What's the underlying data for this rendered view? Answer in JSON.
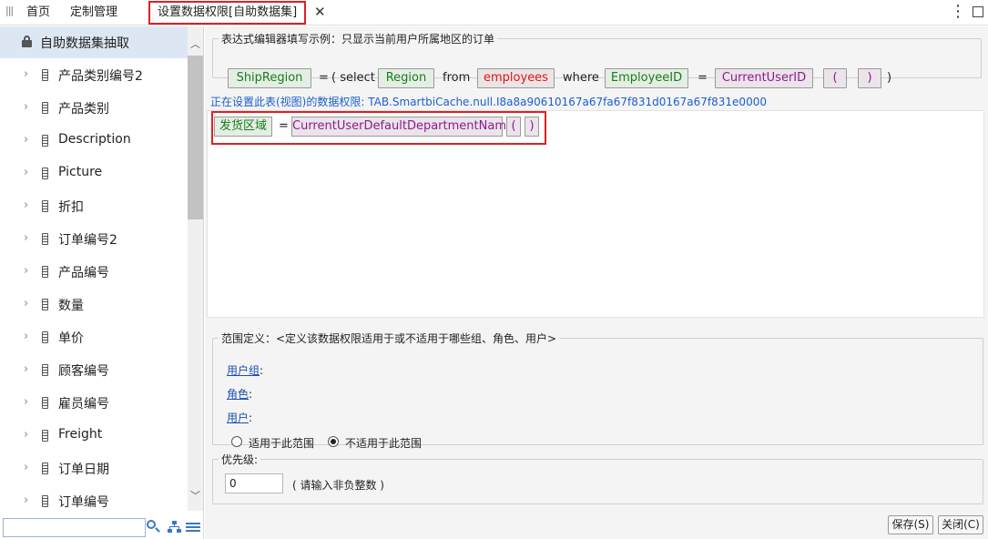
{
  "tabs": [
    {
      "label": "首页"
    },
    {
      "label": "定制管理"
    },
    {
      "label": "设置数据权限[自助数据集]"
    }
  ],
  "sidebar": {
    "root_label": "自助数据集抽取",
    "items": [
      {
        "label": "产品类别编号2"
      },
      {
        "label": "产品类别"
      },
      {
        "label": "Description"
      },
      {
        "label": "Picture"
      },
      {
        "label": "折扣"
      },
      {
        "label": "订单编号2"
      },
      {
        "label": "产品编号"
      },
      {
        "label": "数量"
      },
      {
        "label": "单价"
      },
      {
        "label": "顾客编号"
      },
      {
        "label": "雇员编号"
      },
      {
        "label": "Freight"
      },
      {
        "label": "订单日期"
      },
      {
        "label": "订单编号"
      }
    ],
    "search_value": ""
  },
  "example": {
    "legend": "表达式编辑器填写示例：只显示当前用户所属地区的订单",
    "ship_region": "ShipRegion",
    "eq1": "=",
    "lparen_select": "( select",
    "region": "Region",
    "from": "from",
    "employees": "employees",
    "where": "where",
    "employee_id": "EmployeeID",
    "eq2": "=",
    "current_user_id": "CurrentUserID",
    "lparen": "(",
    "rparen": ")",
    "rparen_end": ")"
  },
  "permission": {
    "label": "正在设置此表(视图)的数据权限: TAB.SmartbiCache.null.I8a8a90610167a67fa67f831d0167a67f831e0000",
    "field": "发货区域",
    "eq": "=",
    "func": "CurrentUserDefaultDepartmentName",
    "lparen": "(",
    "rparen": ")"
  },
  "scope": {
    "legend": "范围定义：<定义该数据权限适用于或不适用于哪些组、角色、用户>",
    "user_group_link": "用户组",
    "role_link": "角色",
    "user_link": "用户",
    "colon": ":",
    "apply_label": "适用于此范围",
    "not_apply_label": "不适用于此范围",
    "selected": "not_apply"
  },
  "priority": {
    "legend": "优先级:",
    "value": "0",
    "hint": "( 请输入非负整数 )"
  },
  "buttons": {
    "save": "保存(S)",
    "close": "关闭(C)"
  },
  "colors": {
    "highlight_border": "#e02020",
    "token_green_text": "#177d1a",
    "token_red_text": "#e01414",
    "token_purple_text": "#8d1b8d",
    "link_blue": "#1a5fd0",
    "sidebar_selected": "#dde7f3"
  }
}
